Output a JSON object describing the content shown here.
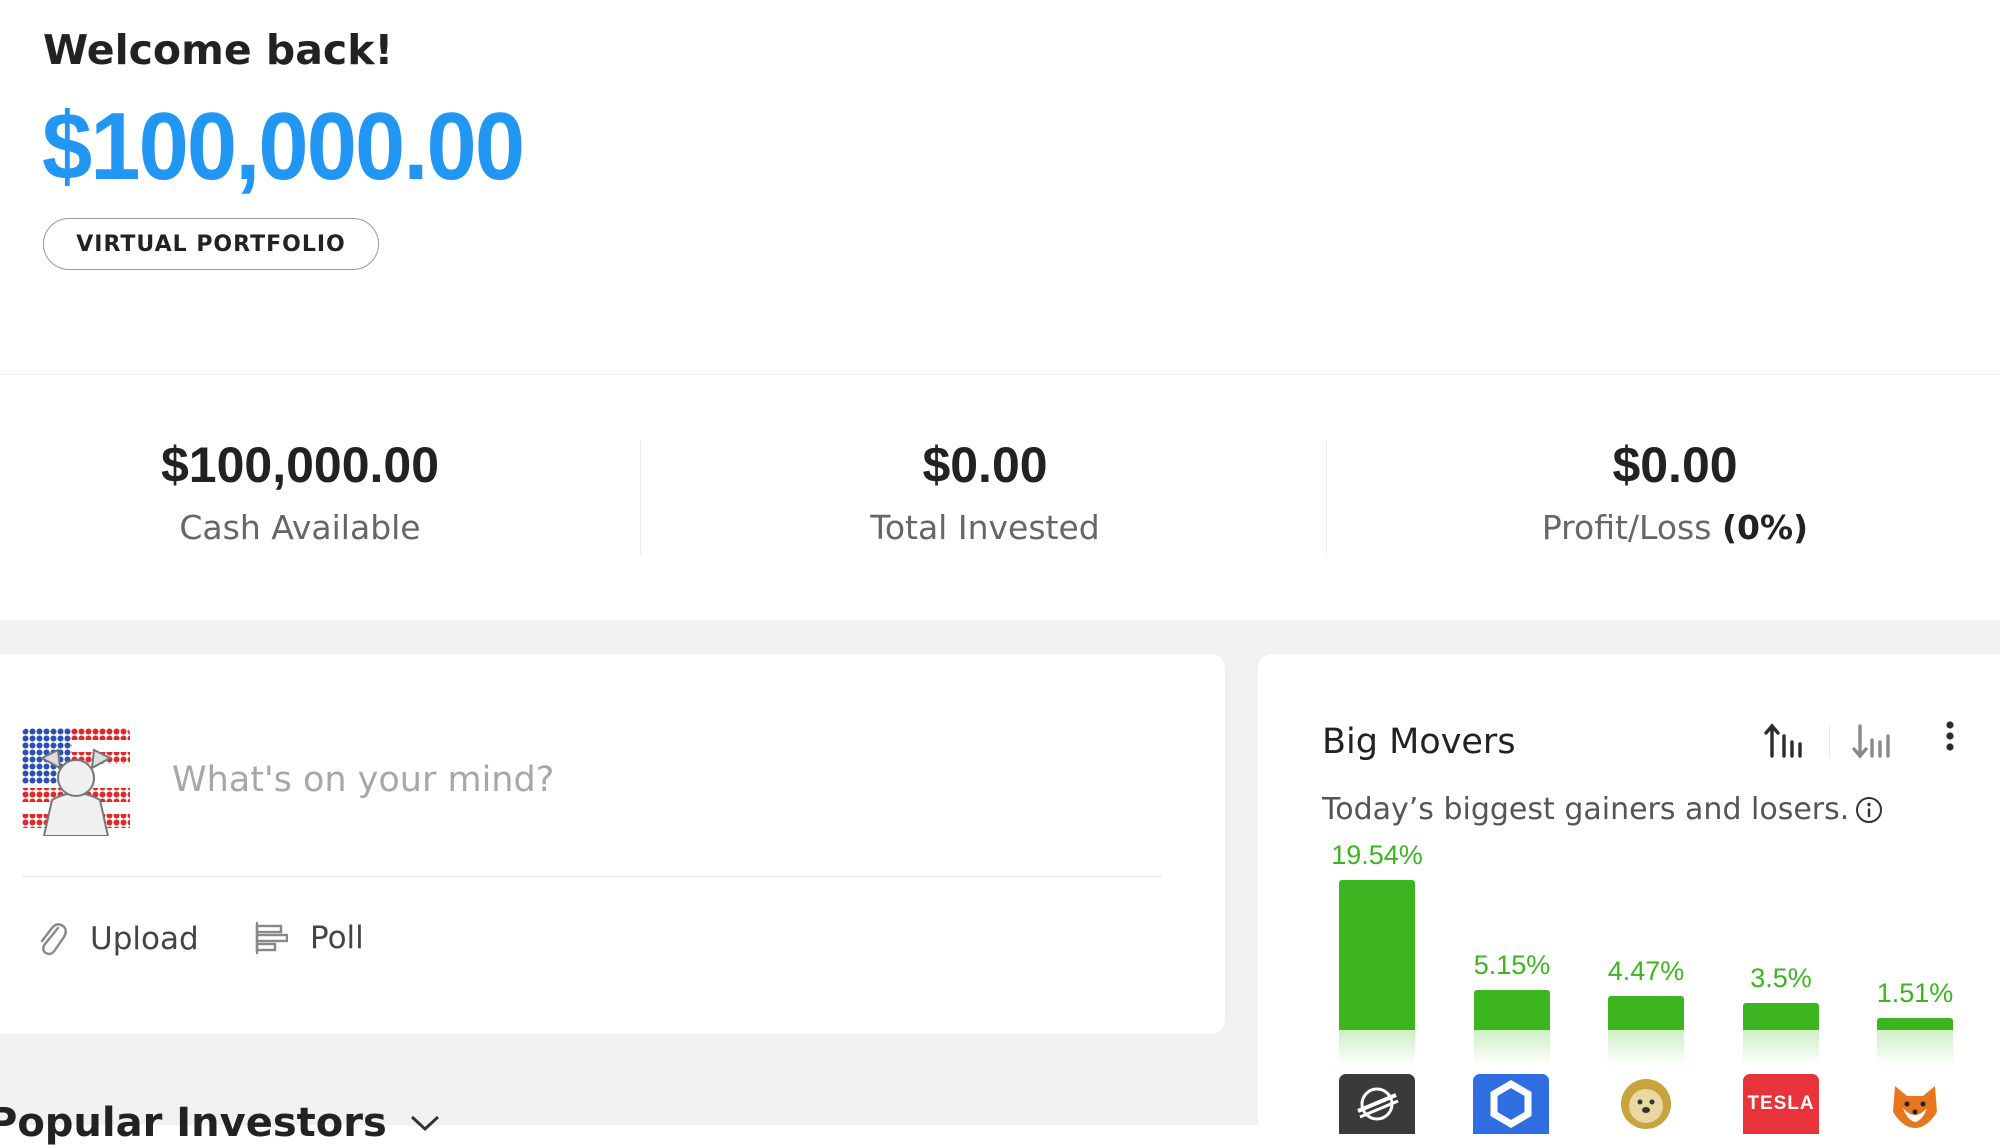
{
  "header": {
    "greeting": "Welcome back!",
    "balance": "$100,000.00",
    "portfolio_button": "VIRTUAL PORTFOLIO"
  },
  "stats": [
    {
      "value": "$100,000.00",
      "label": "Cash Available"
    },
    {
      "value": "$0.00",
      "label": "Total Invested"
    },
    {
      "value": "$0.00",
      "label": "Profit/Loss",
      "pct": "(0%)"
    }
  ],
  "post": {
    "placeholder": "What's on your mind?",
    "upload_label": "Upload",
    "poll_label": "Poll"
  },
  "popular": {
    "title": "Popular Investors"
  },
  "movers": {
    "title": "Big Movers",
    "subtitle": "Today’s biggest gainers and losers.",
    "items": [
      {
        "change": "19.54%",
        "value": 19.54,
        "logo": "stellar-logo-icon"
      },
      {
        "change": "5.15%",
        "value": 5.15,
        "logo": "chainlink-logo-icon"
      },
      {
        "change": "4.47%",
        "value": 4.47,
        "logo": "dogecoin-logo-icon"
      },
      {
        "change": "3.5%",
        "value": 3.5,
        "logo": "tesla-logo-icon",
        "logo_text": "TESLA"
      },
      {
        "change": "1.51%",
        "value": 1.51,
        "logo": "shiba-inu-logo-icon"
      }
    ]
  },
  "colors": {
    "accent": "#2196f3",
    "gain": "#3cb521",
    "background": "#f1f1f1"
  }
}
